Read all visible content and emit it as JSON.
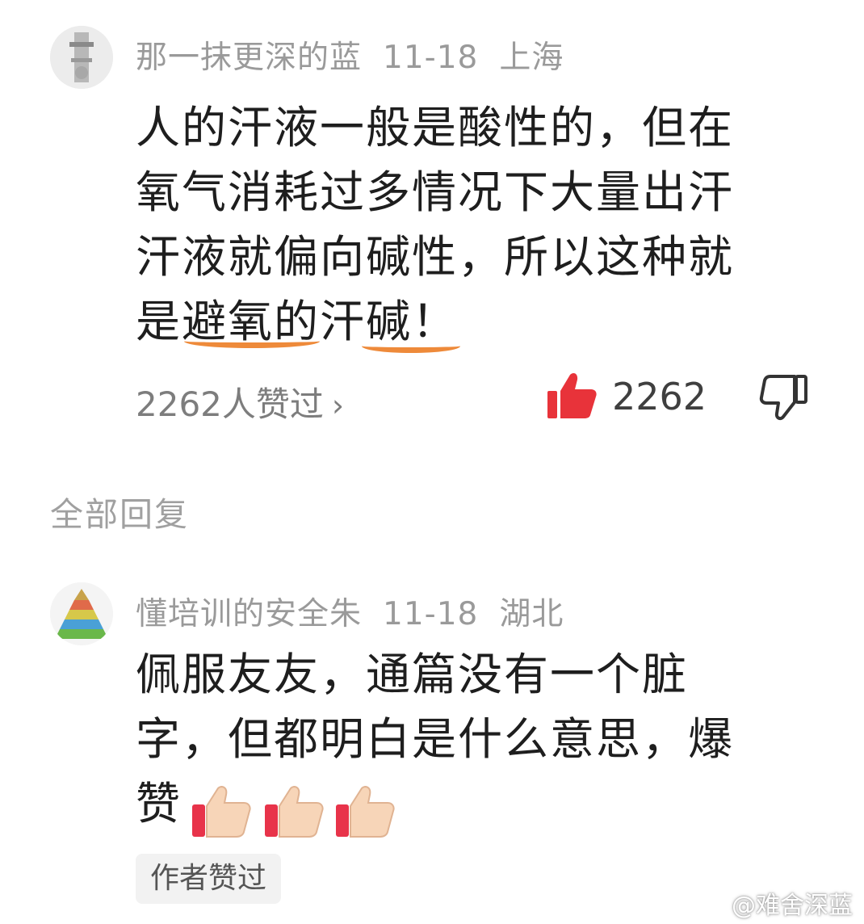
{
  "comment": {
    "username": "那一抹更深的蓝",
    "date": "11-18",
    "location": "上海",
    "lines": [
      "人的汗液一般是酸性的，但在",
      "氧气消耗过多情况下大量出汗",
      "汗液就偏向碱性，所以这种就",
      "是避氧的汗碱！"
    ],
    "likes_summary": "2262人赞过",
    "like_count": "2262"
  },
  "replies_section_title": "全部回复",
  "reply": {
    "username": "懂培训的安全朱",
    "date": "11-18",
    "location": "湖北",
    "lines": [
      "佩服友友，通篇没有一个脏",
      "字，但都明白是什么意思，爆",
      "赞"
    ],
    "emoji": [
      "thumbs-up-emoji",
      "thumbs-up-emoji",
      "thumbs-up-emoji"
    ],
    "author_liked_badge": "作者赞过"
  },
  "watermark": "@难舍深蓝",
  "colors": {
    "highlight_underline": "#ee8a3a",
    "like_icon": "#e8333a",
    "meta_text": "#9a9a9a"
  }
}
